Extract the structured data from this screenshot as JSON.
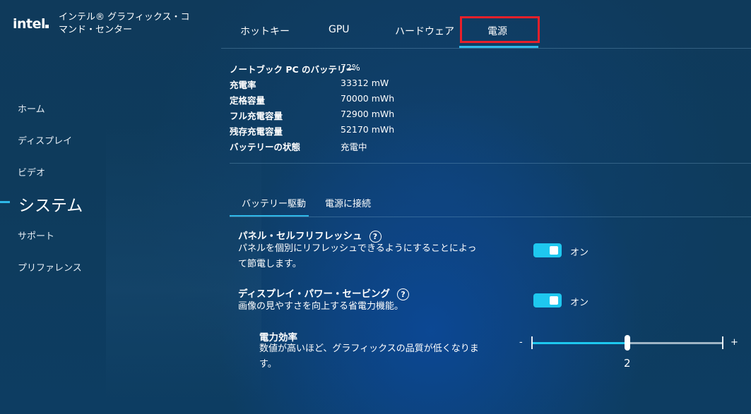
{
  "app": {
    "logo": "intel",
    "title": "インテル® グラフィックス・コマンド・センター"
  },
  "sidebar": {
    "items": [
      {
        "label": "ホーム"
      },
      {
        "label": "ディスプレイ"
      },
      {
        "label": "ビデオ"
      },
      {
        "label": "システム"
      },
      {
        "label": "サポート"
      },
      {
        "label": "プリファレンス"
      }
    ],
    "active": "システム"
  },
  "tabs": {
    "items": [
      {
        "label": "ホットキー"
      },
      {
        "label": "GPU"
      },
      {
        "label": "ハードウェア"
      },
      {
        "label": "電源"
      }
    ],
    "active": "電源"
  },
  "battery": {
    "rows": [
      {
        "label": "ノートブック PC のバッテリー",
        "value": "72%"
      },
      {
        "label": "充電率",
        "value": "33312 mW"
      },
      {
        "label": "定格容量",
        "value": "70000 mWh"
      },
      {
        "label": "フル充電容量",
        "value": "72900 mWh"
      },
      {
        "label": "残存充電容量",
        "value": "52170 mWh"
      },
      {
        "label": "バッテリーの状態",
        "value": "充電中"
      }
    ]
  },
  "subtabs": {
    "items": [
      {
        "label": "バッテリー駆動"
      },
      {
        "label": "電源に接続"
      }
    ],
    "active": "バッテリー駆動"
  },
  "settings": {
    "panel_self_refresh": {
      "title": "パネル・セルフリフレッシュ",
      "help": "?",
      "desc_line1": "パネルを個別にリフレッシュできるようにすることによっ",
      "desc_line2": "て節電します。",
      "toggle_label": "オン",
      "enabled": true
    },
    "display_power_saving": {
      "title": "ディスプレイ・パワー・セービング",
      "help": "?",
      "desc": "画像の見やすさを向上する省電力機能。",
      "toggle_label": "オン",
      "enabled": true,
      "efficiency": {
        "title": "電力効率",
        "desc_line1": "数値が高いほど、グラフィックスの品質が低くなりま",
        "desc_line2": "す。",
        "minus": "-",
        "plus": "+",
        "value": "2",
        "level_fraction": 0.5
      }
    }
  },
  "colors": {
    "accent": "#1ec8ef",
    "highlight_box": "#e8202a",
    "background": "#0d3a5c"
  }
}
